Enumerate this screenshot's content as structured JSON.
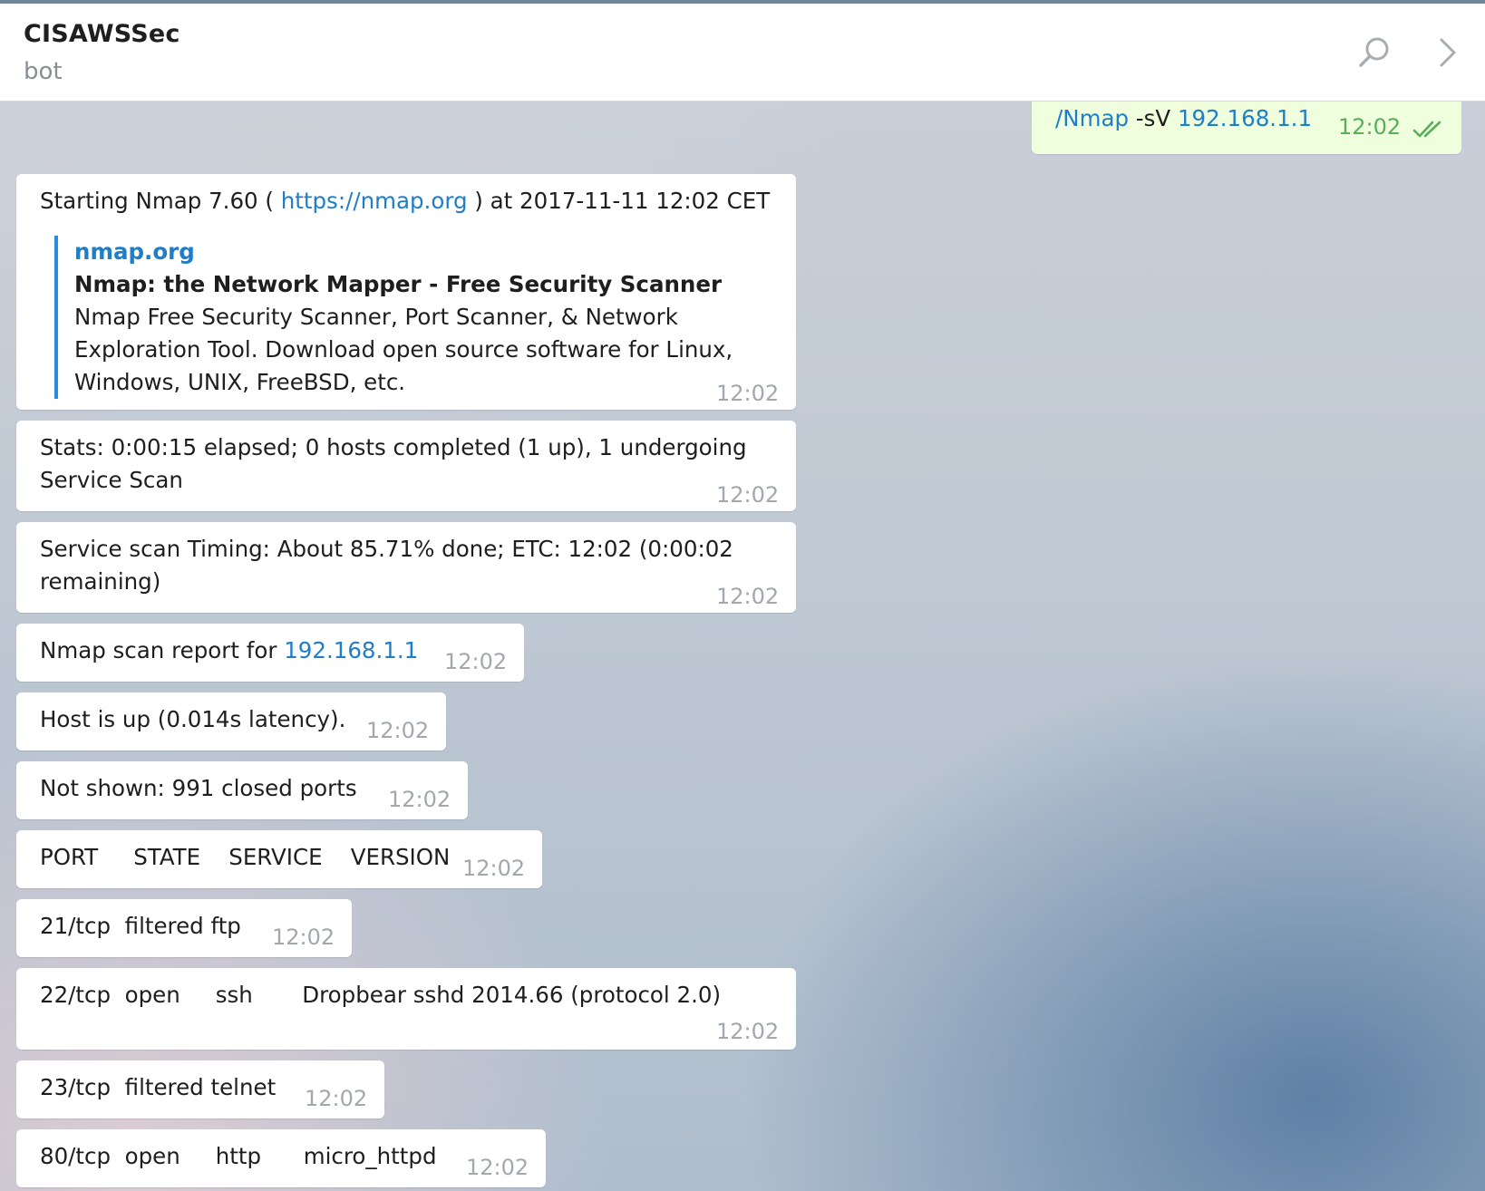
{
  "header": {
    "title": "CISAWSSec",
    "subtitle": "bot"
  },
  "outgoing": {
    "command": "/Nmap",
    "flag": " -sV ",
    "ip": "192.168.1.1",
    "time": "12:02"
  },
  "msg1": {
    "prefix": "Starting Nmap 7.60 ( ",
    "link": "https://nmap.org",
    "suffix": " ) at 2017-11-11 12:02 CET",
    "preview_site": "nmap.org",
    "preview_title": "Nmap: the Network Mapper - Free Security Scanner",
    "preview_desc_1": "Nmap Free Security Scanner, Port Scanner, & Network",
    "preview_desc_2": "Exploration Tool. Download open source software for Linux,",
    "preview_desc_3": "Windows, UNIX, FreeBSD, etc.",
    "time": "12:02"
  },
  "msg2": {
    "line1": "Stats: 0:00:15 elapsed; 0 hosts completed (1 up), 1 undergoing",
    "line2": "Service Scan",
    "time": "12:02"
  },
  "msg3": {
    "line1": "Service scan Timing: About 85.71% done; ETC: 12:02 (0:00:02",
    "line2": "remaining)",
    "time": "12:02"
  },
  "msg4": {
    "prefix": "Nmap scan report for ",
    "ip": "192.168.1.1",
    "time": "12:02"
  },
  "msg5": {
    "text": "Host is up (0.014s latency).",
    "time": "12:02"
  },
  "msg6": {
    "text": "Not shown: 991 closed ports",
    "time": "12:02"
  },
  "msg7": {
    "text": "PORT     STATE    SERVICE    VERSION",
    "time": "12:02"
  },
  "msg8": {
    "text": "21/tcp  filtered ftp",
    "time": "12:02"
  },
  "msg9": {
    "text": "22/tcp  open     ssh       Dropbear sshd 2014.66 (protocol 2.0)",
    "time": "12:02"
  },
  "msg10": {
    "text": "23/tcp  filtered telnet",
    "time": "12:02"
  },
  "msg11": {
    "text": "80/tcp  open     http      micro_httpd",
    "time": "12:02"
  }
}
